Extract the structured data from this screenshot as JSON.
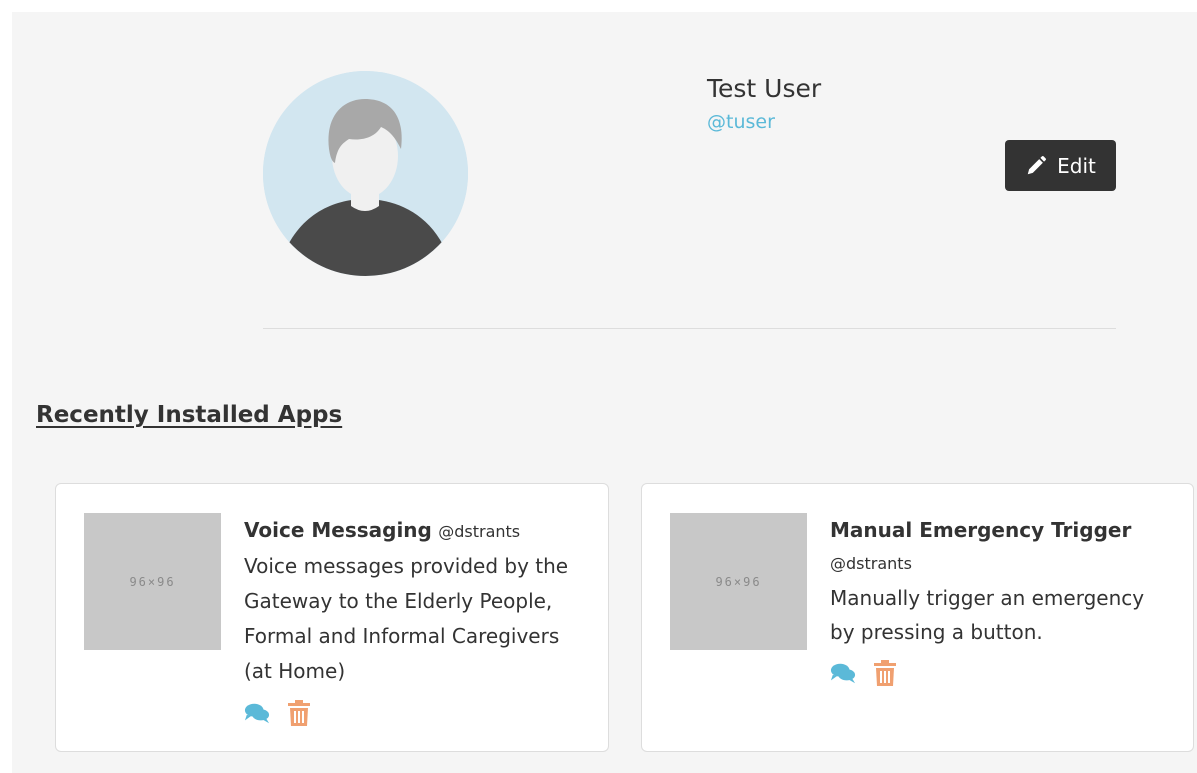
{
  "profile": {
    "name": "Test User",
    "handle": "@tuser",
    "edit_label": "Edit"
  },
  "section": {
    "title": "Recently Installed Apps"
  },
  "apps": [
    {
      "name": "Voice Messaging",
      "author": "@dstrants",
      "description": "Voice messages provided by the Gateway to the Elderly People, Formal and Informal Caregivers (at Home)",
      "thumbnail_label": "96×96"
    },
    {
      "name": "Manual Emergency Trigger",
      "author": "@dstrants",
      "description": "Manually trigger an emergency by pressing a button.",
      "thumbnail_label": "96×96"
    }
  ],
  "icons": {
    "edit": "pencil-icon",
    "comments": "comments-icon",
    "delete": "trash-icon"
  },
  "colors": {
    "accent": "#5bb9d8",
    "delete": "#f0a070",
    "button_bg": "#333333",
    "avatar_bg": "#d2e6f0"
  }
}
